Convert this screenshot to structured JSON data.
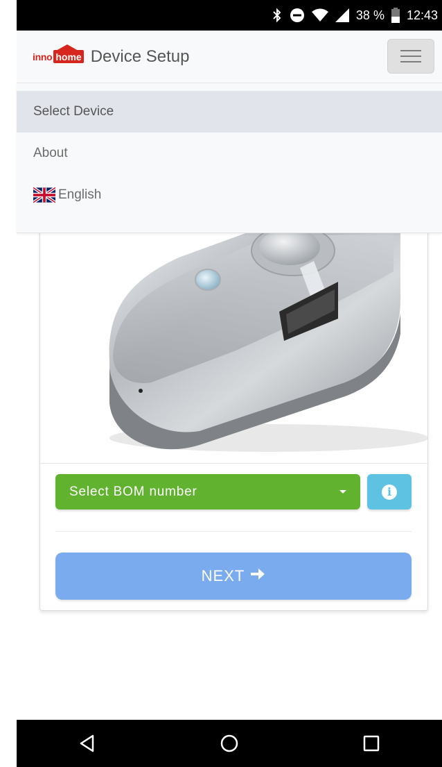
{
  "status_bar": {
    "battery": "38 %",
    "time": "12:43",
    "icons": [
      "bluetooth-icon",
      "do-not-disturb-icon",
      "wifi-icon",
      "signal-icon",
      "battery-icon"
    ]
  },
  "app_bar": {
    "logo_inno": "inno",
    "logo_home": "home",
    "title": "Device Setup",
    "menu_icon": "hamburger-icon"
  },
  "menu": {
    "items": [
      {
        "label": "Select Device",
        "active": true
      },
      {
        "label": "About",
        "active": false
      },
      {
        "label": "English",
        "active": false,
        "icon": "uk-flag-icon"
      }
    ]
  },
  "card": {
    "image": "device-photo",
    "bom_select": {
      "selected": "Select BOM number"
    },
    "info_icon": "i",
    "next_button": {
      "label": "NEXT",
      "icon": "arrow-right-icon"
    }
  },
  "nav_bar": {
    "icons": [
      "back-icon",
      "home-icon",
      "recents-icon"
    ]
  },
  "colors": {
    "bom_green": "#60b22f",
    "info_blue": "#5ec2e3",
    "next_blue": "#7aabef",
    "brand_red": "#d7261e"
  }
}
